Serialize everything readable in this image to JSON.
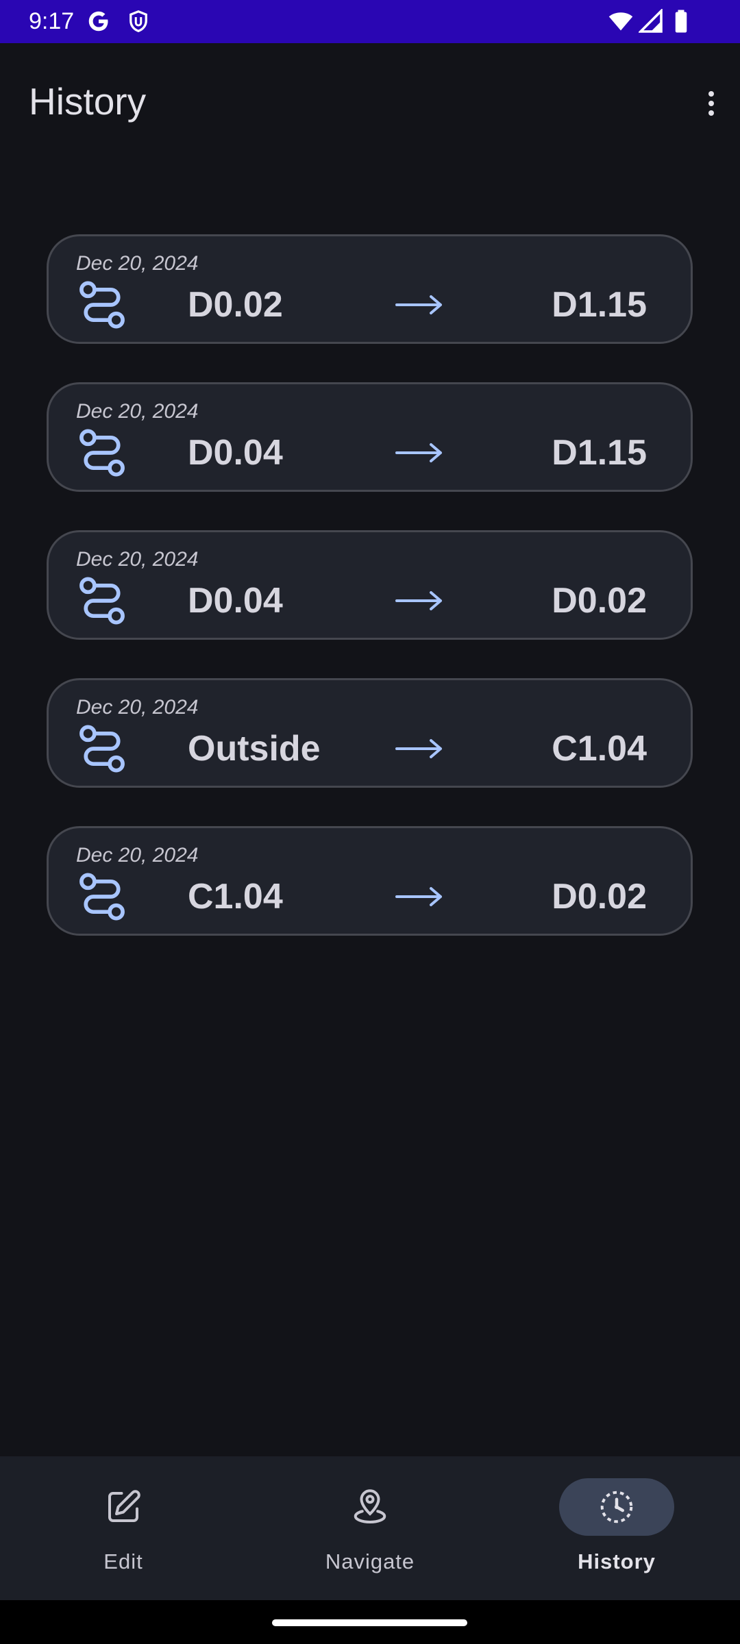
{
  "status_bar": {
    "time": "9:17",
    "left_icons": [
      "google-icon",
      "shield-icon"
    ],
    "right_icons": [
      "wifi-icon",
      "signal-icon",
      "battery-icon"
    ],
    "background": "#2a06b3"
  },
  "app_bar": {
    "title": "History",
    "menu_icon": "more-vert-icon"
  },
  "history": {
    "items": [
      {
        "date": "Dec 20, 2024",
        "from": "D0.02",
        "to": "D1.15"
      },
      {
        "date": "Dec 20, 2024",
        "from": "D0.04",
        "to": "D1.15"
      },
      {
        "date": "Dec 20, 2024",
        "from": "D0.04",
        "to": "D0.02"
      },
      {
        "date": "Dec 20, 2024",
        "from": "Outside",
        "to": "C1.04"
      },
      {
        "date": "Dec 20, 2024",
        "from": "C1.04",
        "to": "D0.02"
      }
    ],
    "route_icon": "route-icon",
    "arrow_icon": "arrow-right-icon",
    "accent": "#a8c5ff"
  },
  "bottom_nav": {
    "items": [
      {
        "label": "Edit",
        "icon": "edit-icon",
        "active": false
      },
      {
        "label": "Navigate",
        "icon": "location-icon",
        "active": false
      },
      {
        "label": "History",
        "icon": "history-icon",
        "active": true
      }
    ]
  }
}
